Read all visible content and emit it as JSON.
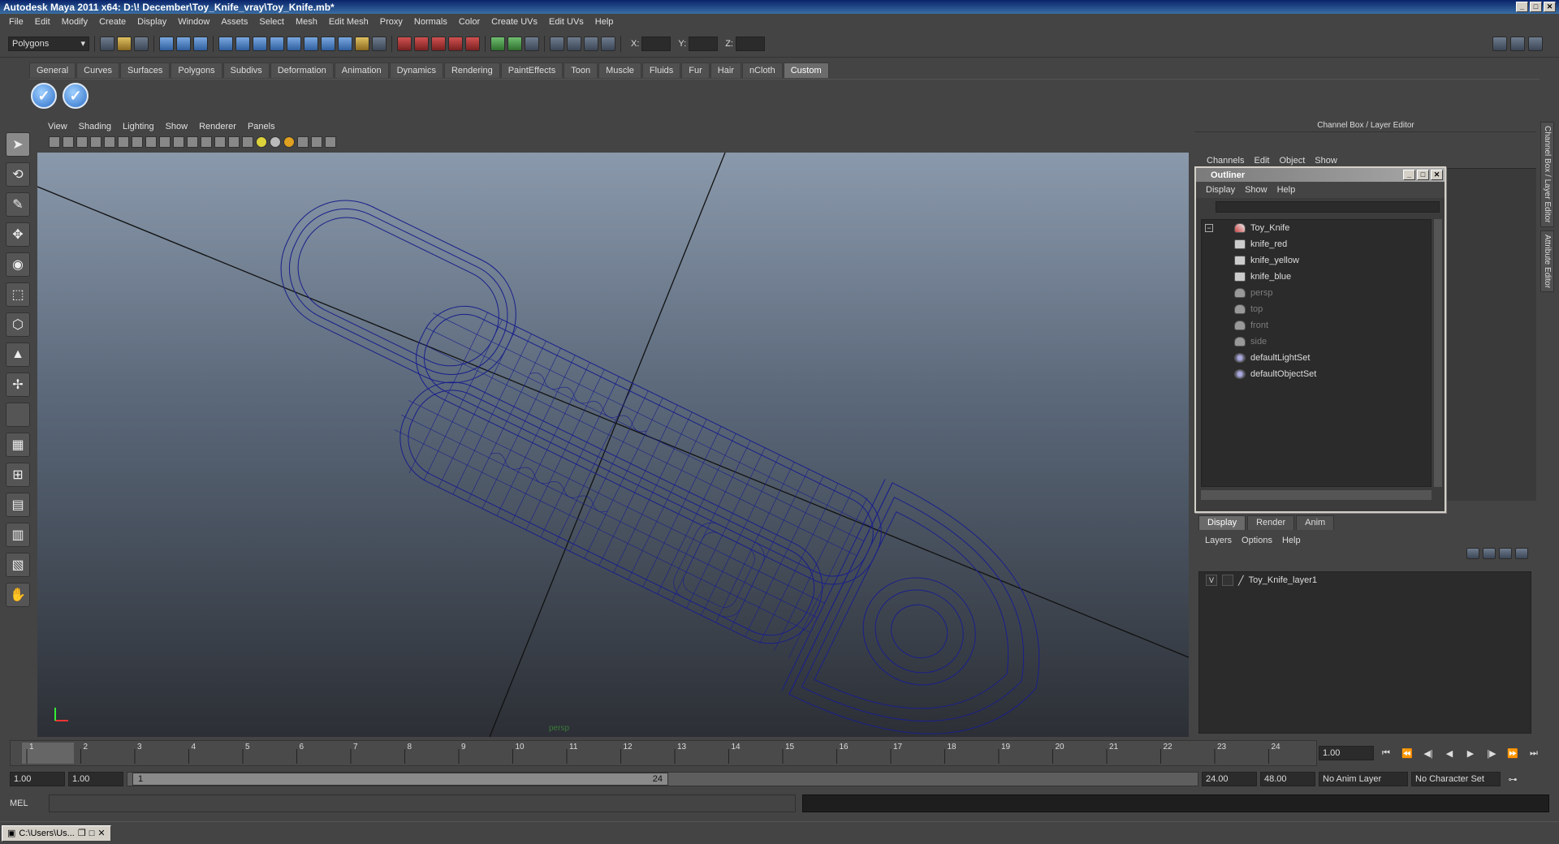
{
  "window": {
    "title": "Autodesk Maya 2011 x64: D:\\! December\\Toy_Knife_vray\\Toy_Knife.mb*"
  },
  "menubar": [
    "File",
    "Edit",
    "Modify",
    "Create",
    "Display",
    "Window",
    "Assets",
    "Select",
    "Mesh",
    "Edit Mesh",
    "Proxy",
    "Normals",
    "Color",
    "Create UVs",
    "Edit UVs",
    "Help"
  ],
  "statusline": {
    "mode": "Polygons",
    "x_label": "X:",
    "y_label": "Y:",
    "z_label": "Z:"
  },
  "shelf": {
    "tabs": [
      "General",
      "Curves",
      "Surfaces",
      "Polygons",
      "Subdivs",
      "Deformation",
      "Animation",
      "Dynamics",
      "Rendering",
      "PaintEffects",
      "Toon",
      "Muscle",
      "Fluids",
      "Fur",
      "Hair",
      "nCloth",
      "Custom"
    ],
    "active": "Custom"
  },
  "viewport": {
    "menus": [
      "View",
      "Shading",
      "Lighting",
      "Show",
      "Renderer",
      "Panels"
    ],
    "camera": "persp",
    "wire_color": "#1a1f8a"
  },
  "channelbox": {
    "title": "Channel Box / Layer Editor",
    "menus": [
      "Channels",
      "Edit",
      "Object",
      "Show"
    ]
  },
  "outliner": {
    "title": "Outliner",
    "menus": [
      "Display",
      "Show",
      "Help"
    ],
    "items": [
      {
        "label": "Toy_Knife",
        "indent": 0,
        "icon": "transform-icon",
        "dim": false
      },
      {
        "label": "knife_red",
        "indent": 1,
        "icon": "mesh-icon",
        "dim": false
      },
      {
        "label": "knife_yellow",
        "indent": 1,
        "icon": "mesh-icon",
        "dim": false
      },
      {
        "label": "knife_blue",
        "indent": 1,
        "icon": "mesh-icon",
        "dim": false
      },
      {
        "label": "persp",
        "indent": 0,
        "icon": "camera-icon",
        "dim": true
      },
      {
        "label": "top",
        "indent": 0,
        "icon": "camera-icon",
        "dim": true
      },
      {
        "label": "front",
        "indent": 0,
        "icon": "camera-icon",
        "dim": true
      },
      {
        "label": "side",
        "indent": 0,
        "icon": "camera-icon",
        "dim": true
      },
      {
        "label": "defaultLightSet",
        "indent": 0,
        "icon": "set-icon",
        "dim": false
      },
      {
        "label": "defaultObjectSet",
        "indent": 0,
        "icon": "set-icon",
        "dim": false
      }
    ]
  },
  "layers": {
    "tabs": [
      "Display",
      "Render",
      "Anim"
    ],
    "active": "Display",
    "menus": [
      "Layers",
      "Options",
      "Help"
    ],
    "rows": [
      {
        "visible": "V",
        "name": "Toy_Knife_layer1"
      }
    ]
  },
  "sidetabs": [
    "Channel Box / Layer Editor",
    "Attribute Editor"
  ],
  "timeline": {
    "ticks": [
      1,
      2,
      3,
      4,
      5,
      6,
      7,
      8,
      9,
      10,
      11,
      12,
      13,
      14,
      15,
      16,
      17,
      18,
      19,
      20,
      21,
      22,
      23,
      24
    ],
    "current_frame": "1.00"
  },
  "range": {
    "start": "1.00",
    "playback_start": "1.00",
    "slider_start": "1",
    "slider_end": "24",
    "playback_end": "24.00",
    "end": "48.00",
    "anim_layer": "No Anim Layer",
    "character_set": "No Character Set"
  },
  "mel": {
    "label": "MEL"
  },
  "taskbar": {
    "item": "C:\\Users\\Us..."
  }
}
